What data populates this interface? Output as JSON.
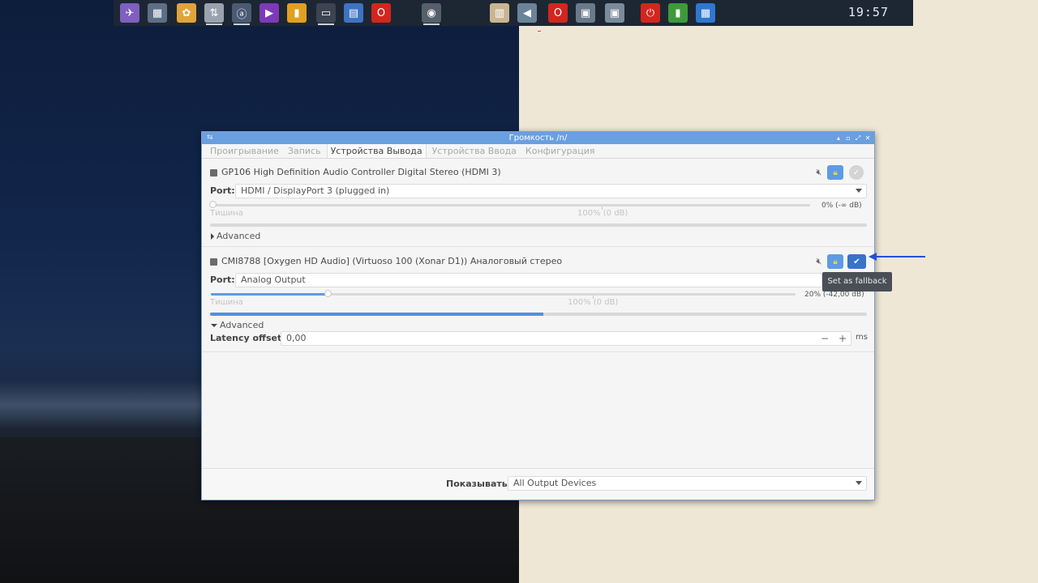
{
  "panel": {
    "clock": "19:57",
    "launchers": [
      {
        "icon": "telegram-icon",
        "color": "#7f5fbf",
        "glyph": "✈"
      },
      {
        "icon": "calculator-icon",
        "color": "#5c6f86",
        "glyph": "▦"
      },
      {
        "icon": "paint-palette-icon",
        "color": "#e0a43a",
        "glyph": "✿"
      },
      {
        "icon": "arrows-updown-icon",
        "color": "#9aa3ad",
        "glyph": "⇅"
      },
      {
        "icon": "circle-a-icon",
        "color": "#4a5a72",
        "glyph": "ⓐ"
      },
      {
        "icon": "media-player-icon",
        "color": "#7c3ab8",
        "glyph": "▶"
      },
      {
        "icon": "audio-equalizer-icon",
        "color": "#e0a020",
        "glyph": "▮"
      },
      {
        "icon": "terminal-icon",
        "color": "#3b4450",
        "glyph": "▭"
      },
      {
        "icon": "file-manager-icon",
        "color": "#3d73c2",
        "glyph": "▤"
      },
      {
        "icon": "opera-browser-icon",
        "color": "#d2261f",
        "glyph": "O"
      },
      {
        "icon": "disk-utility-icon",
        "color": "#56606b",
        "glyph": "◉"
      },
      {
        "icon": "notepad-icon",
        "color": "#c9b592",
        "glyph": "▥"
      },
      {
        "icon": "volume-control-icon",
        "color": "#6b8399",
        "glyph": "◀"
      },
      {
        "icon": "opera-browser-icon",
        "color": "#d2261f",
        "glyph": "O"
      },
      {
        "icon": "window-thumbnail-icon",
        "color": "#6a7a8b",
        "glyph": "▣"
      },
      {
        "icon": "window-thumbnail-icon",
        "color": "#7b8b9b",
        "glyph": "▣"
      },
      {
        "icon": "power-icon",
        "color": "#d2261f",
        "glyph": "⏻"
      },
      {
        "icon": "system-monitor-icon",
        "color": "#3d9a3a",
        "glyph": "▮"
      },
      {
        "icon": "network-icon",
        "color": "#2f77d0",
        "glyph": "▦"
      }
    ]
  },
  "window": {
    "title": "Громкость   /n/",
    "tabs": [
      "Проигрывание",
      "Запись",
      "Устройства Вывода",
      "Устройства Ввода",
      "Конфигурация"
    ],
    "active_tab": "Устройства Вывода",
    "devices": [
      {
        "name": "GP106 High Definition Audio Controller Digital Stereo (HDMI 3)",
        "port_label": "Port:",
        "port_value": "HDMI / DisplayPort 3 (plugged in)",
        "volume_text": "0% (-∞ dB)",
        "volume_fraction": 0.0,
        "silence_label": "Тишина",
        "hundred_label": "100% (0 dB)",
        "meter_fraction": 0.0,
        "advanced_label": "Advanced",
        "expanded": false,
        "fallback": false
      },
      {
        "name": "CMI8788 [Oxygen HD Audio] (Virtuoso 100 (Xonar D1)) Аналоговый стерео",
        "port_label": "Port:",
        "port_value": "Analog Output",
        "volume_text": "20% (-42,00 dB)",
        "volume_fraction": 0.2,
        "silence_label": "Тишина",
        "hundred_label": "100% (0 dB)",
        "meter_fraction": 0.508,
        "advanced_label": "Advanced",
        "expanded": true,
        "fallback": true,
        "latency_label": "Latency offset:",
        "latency_value": "0,00",
        "latency_unit": "ms"
      }
    ],
    "show_label": "Показывать:",
    "show_value": "All Output Devices"
  },
  "tooltip": "Set as fallback"
}
